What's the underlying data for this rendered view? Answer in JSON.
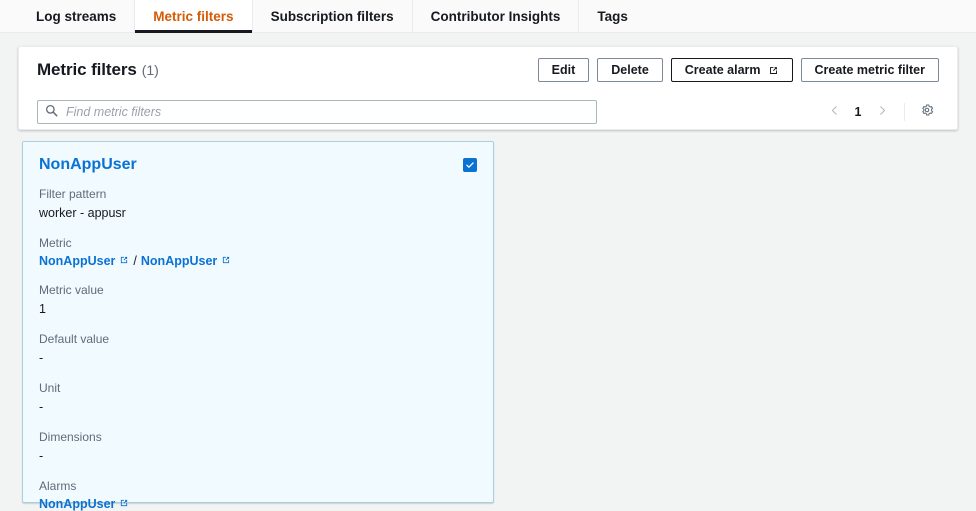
{
  "tabs": [
    {
      "label": "Log streams",
      "active": false
    },
    {
      "label": "Metric filters",
      "active": true
    },
    {
      "label": "Subscription filters",
      "active": false
    },
    {
      "label": "Contributor Insights",
      "active": false
    },
    {
      "label": "Tags",
      "active": false
    }
  ],
  "header": {
    "title": "Metric filters",
    "count": "(1)",
    "buttons": [
      {
        "label": "Edit",
        "icon": null,
        "strong": false
      },
      {
        "label": "Delete",
        "icon": null,
        "strong": false
      },
      {
        "label": "Create alarm",
        "icon": "external-link-icon",
        "strong": true
      },
      {
        "label": "Create metric filter",
        "icon": null,
        "strong": false
      }
    ]
  },
  "search": {
    "placeholder": "Find metric filters",
    "value": "",
    "icon": "search-icon"
  },
  "pagination": {
    "prev_icon": "chevron-left-icon",
    "page": "1",
    "next_icon": "chevron-right-icon",
    "settings_icon": "gear-icon"
  },
  "card": {
    "title": "NonAppUser",
    "selected": true,
    "fields": [
      {
        "label": "Filter pattern",
        "value": "worker - appusr",
        "type": "text"
      },
      {
        "label": "Metric",
        "type": "links",
        "links": [
          "NonAppUser",
          "NonAppUser"
        ],
        "separator": "/"
      },
      {
        "label": "Metric value",
        "value": "1",
        "type": "text"
      },
      {
        "label": "Default value",
        "value": "-",
        "type": "text"
      },
      {
        "label": "Unit",
        "value": "-",
        "type": "text"
      },
      {
        "label": "Dimensions",
        "value": "-",
        "type": "text"
      },
      {
        "label": "Alarms",
        "type": "links",
        "links": [
          "NonAppUser"
        ],
        "separator": ""
      }
    ]
  },
  "colors": {
    "accent_link": "#0972d3",
    "active_tab": "#d45b07",
    "card_bg": "#f1faff",
    "card_border": "#a6d2e0",
    "page_bg": "#f2f3f3"
  }
}
